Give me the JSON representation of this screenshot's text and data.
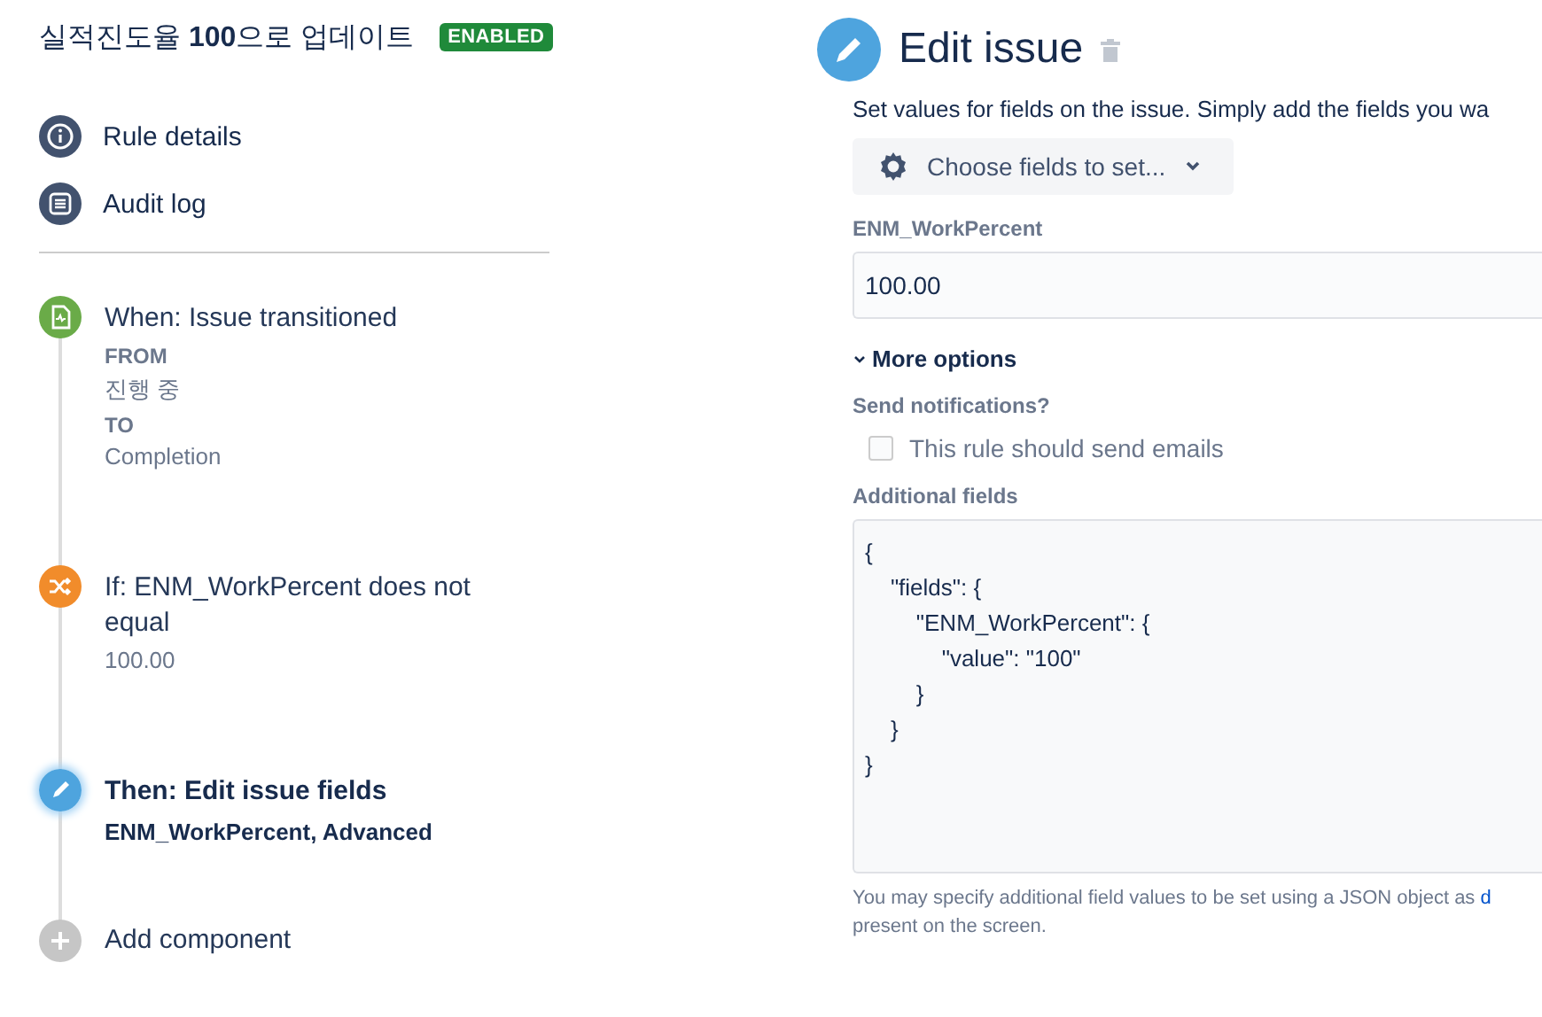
{
  "rule": {
    "title": "실적진도율 **100**으로 업데이트",
    "status": "ENABLED"
  },
  "nav": [
    {
      "kind": "info",
      "label": "Rule details"
    },
    {
      "kind": "log",
      "label": "Audit log"
    }
  ],
  "steps": [
    {
      "kind": "trigger",
      "selected": false,
      "title": "When: Issue transitioned",
      "lines": [
        {
          "kind": "label",
          "text": "FROM"
        },
        {
          "kind": "value",
          "text": "진행 중"
        },
        {
          "kind": "label",
          "text": "TO"
        },
        {
          "kind": "value",
          "text": "Completion"
        }
      ]
    },
    {
      "kind": "condition",
      "selected": false,
      "title": "If: ENM_WorkPercent does not equal",
      "lines": [
        {
          "kind": "value",
          "text": "100.00"
        }
      ]
    },
    {
      "kind": "action",
      "selected": true,
      "title": "Then: Edit issue fields",
      "lines": [
        {
          "kind": "strong",
          "text": "ENM_WorkPercent, Advanced"
        }
      ]
    },
    {
      "kind": "add",
      "selected": false,
      "title": "Add component"
    }
  ],
  "panel": {
    "title": "Edit issue",
    "description": "Set values for fields on the issue. Simply add the fields you wa",
    "choose_button": "Choose fields to set...",
    "field": {
      "label": "ENM_WorkPercent",
      "value": "100.00"
    },
    "more_options": {
      "label": "More options",
      "expanded": true
    },
    "notifications": {
      "label": "Send notifications?",
      "checkbox": "This rule should send emails",
      "checked": false
    },
    "additional_fields": {
      "label": "Additional fields",
      "value": "{\n    \"fields\": {\n        \"ENM_WorkPercent\": {\n            \"value\": \"100\"\n        }\n    }\n}"
    },
    "help": {
      "text": "You may specify additional field values to be set using a JSON object as",
      "link": "d",
      "text_after": "present on the screen."
    }
  }
}
